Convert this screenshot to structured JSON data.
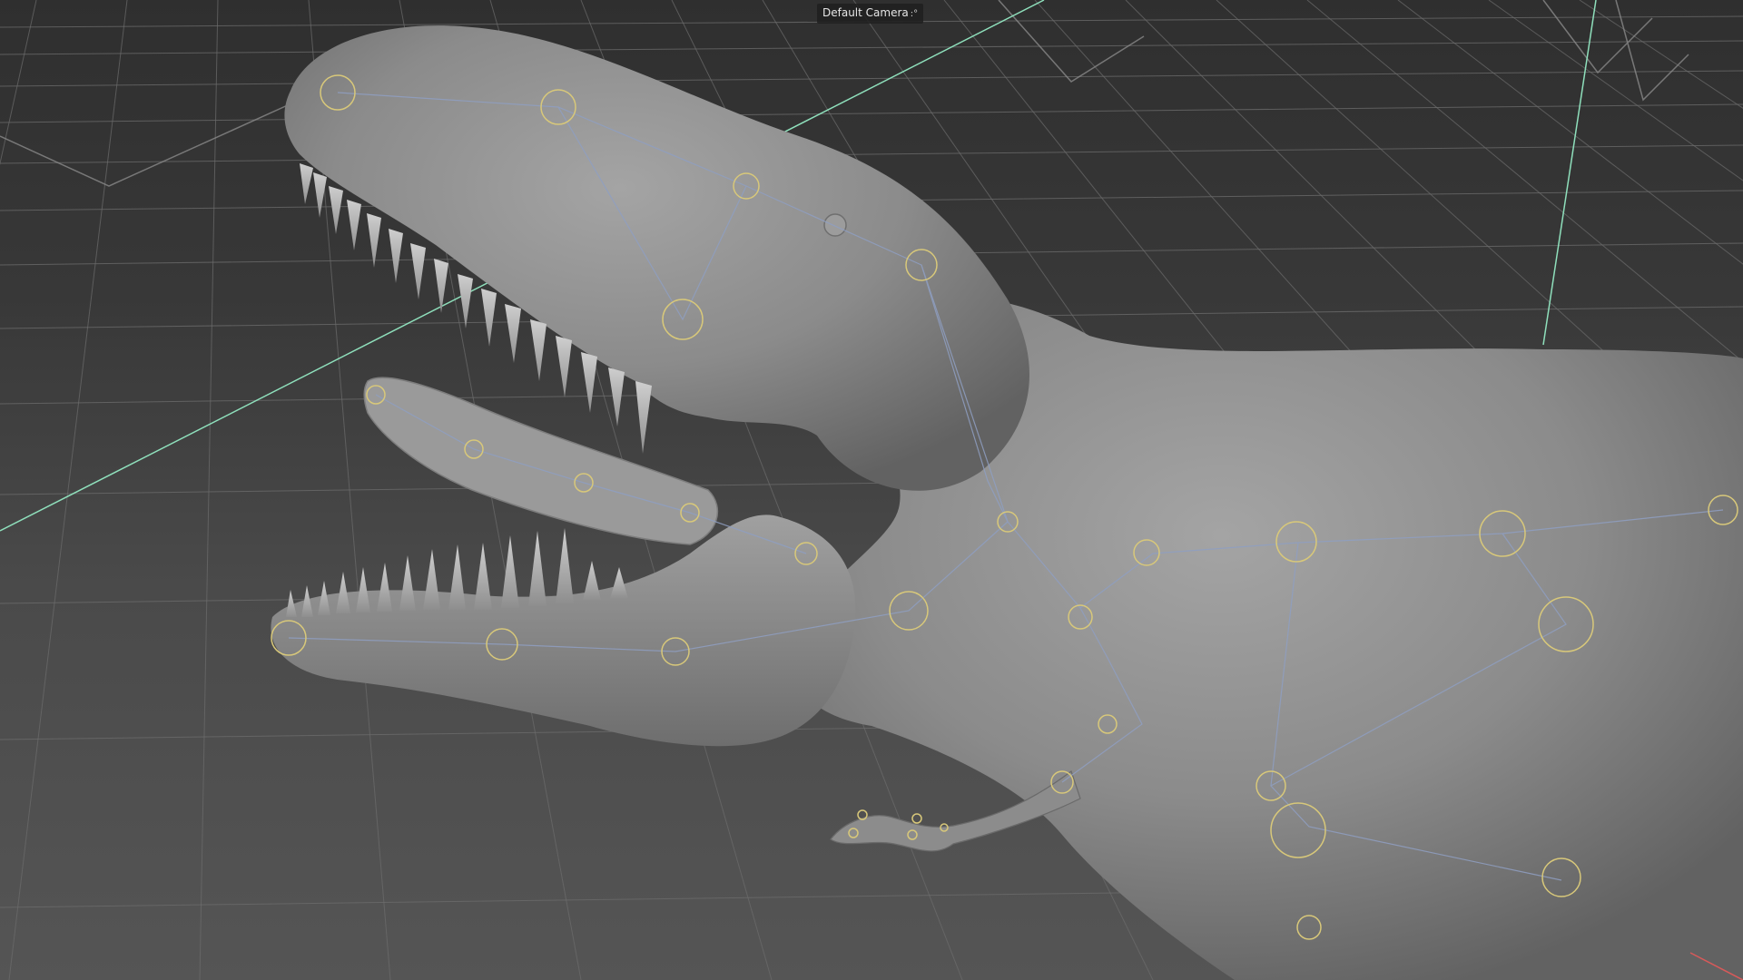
{
  "viewport": {
    "camera_label": "Default Camera",
    "camera_icon": "camera-settings-icon",
    "colors": {
      "background_top": "#2f2f2f",
      "background_bottom": "#555555",
      "grid_line": "#6d6d6d",
      "grid_line_major": "#8a8a8a",
      "axis_x": "#8fe0bc",
      "model_body": "#8a8a8a",
      "joint_circle": "#d8c87a",
      "bone_line": "#8f9fc2"
    }
  }
}
